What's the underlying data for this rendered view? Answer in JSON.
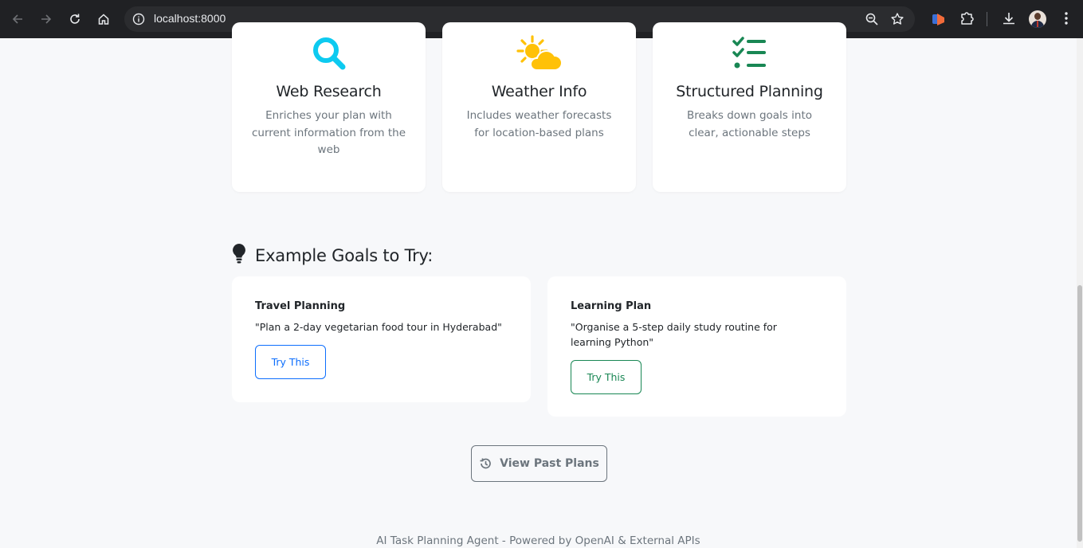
{
  "browser": {
    "url": "localhost:8000"
  },
  "features": [
    {
      "icon": "magnifying-glass-icon",
      "title": "Web Research",
      "description": "Enriches your plan with current information from the web",
      "color": "#0dcaf0"
    },
    {
      "icon": "sun-cloud-icon",
      "title": "Weather Info",
      "description": "Includes weather forecasts for location-based plans",
      "color": "#ffc107"
    },
    {
      "icon": "checklist-icon",
      "title": "Structured Planning",
      "description": "Breaks down goals into clear, actionable steps",
      "color": "#198754"
    }
  ],
  "examples_section": {
    "icon": "lightbulb-icon",
    "title": "Example Goals to Try:"
  },
  "examples": [
    {
      "title": "Travel Planning",
      "goal": "\"Plan a 2-day vegetarian food tour in Hyderabad\"",
      "button": "Try This",
      "color": "#0d6efd"
    },
    {
      "title": "Learning Plan",
      "goal": "\"Organise a 5-step daily study routine for learning Python\"",
      "button": "Try This",
      "color": "#198754"
    }
  ],
  "view_past": {
    "icon": "history-icon",
    "label": "View Past Plans"
  },
  "footer": {
    "text": "AI Task Planning Agent - Powered by OpenAI & External APIs"
  }
}
